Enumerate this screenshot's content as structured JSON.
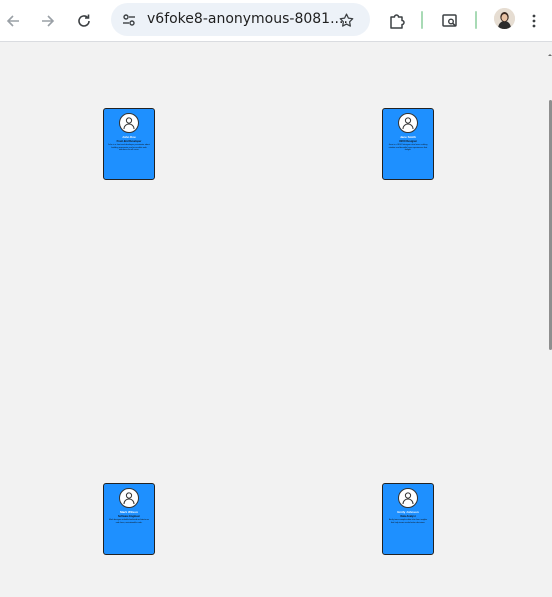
{
  "browser": {
    "url": "v6foke8-anonymous-8081....",
    "icons": {
      "back": "back-arrow-icon",
      "forward": "forward-arrow-icon",
      "reload": "reload-icon",
      "site_info": "tune-icon",
      "bookmark": "star-icon",
      "extensions": "puzzle-icon",
      "lens": "search-in-page-icon",
      "menu": "kebab-menu-icon"
    }
  },
  "cards": [
    {
      "name": "John Doe",
      "role": "Front-End Developer",
      "bio": "John is a front-end developer passionate about building responsive and accessible web interfaces for all users."
    },
    {
      "name": "Jane Smith",
      "role": "UI/UX Designer",
      "bio": "Jane is a UI/UX designer who loves crafting intuitive and beautiful user experiences that delight."
    },
    {
      "name": "Mark Wilson",
      "role": "Software Engineer",
      "bio": "Mark designs scalable backend architectures and clean, maintainable code."
    },
    {
      "name": "Emily Johnson",
      "role": "Data Analyst",
      "bio": "Emily turns complex data into clear insights that help teams make better decisions."
    }
  ],
  "colors": {
    "card_bg": "#1e90ff",
    "page_bg": "#f2f2f2",
    "toolbar_bg": "#ffffff"
  }
}
